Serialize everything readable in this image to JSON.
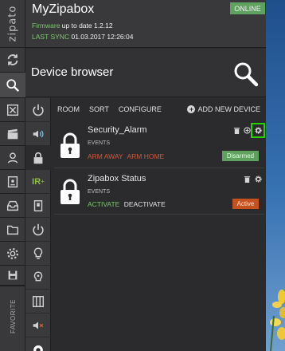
{
  "brand": "zipato",
  "header": {
    "title": "MyZipabox",
    "status_badge": "ONLINE",
    "firmware_label": "Firmware",
    "firmware_text": "up to date 1.2.12",
    "sync_label": "LAST SYNC",
    "sync_text": "01.03.2017 12:26:04"
  },
  "browser": {
    "title": "Device browser"
  },
  "toolbar": {
    "room": "ROOM",
    "sort": "SORT",
    "configure": "CONFIGURE",
    "add_new_device": "ADD NEW DEVICE"
  },
  "favorite_label": "FAVORITE",
  "categories": {
    "ir_label": "IR"
  },
  "devices": [
    {
      "name": "Security_Alarm",
      "events_label": "EVENTS",
      "actions": [
        "ARM AWAY",
        "ARM HOME"
      ],
      "status": "Disarmed",
      "status_color": "#5fa15f"
    },
    {
      "name": "Zipabox Status",
      "events_label": "EVENTS",
      "actions": [
        "ACTIVATE",
        "DEACTIVATE"
      ],
      "status": "Active",
      "status_color": "#c5511e"
    }
  ],
  "colors": {
    "accent_green": "#7cc86e",
    "alert_red": "#d05a3a",
    "highlight": "#27d000"
  }
}
